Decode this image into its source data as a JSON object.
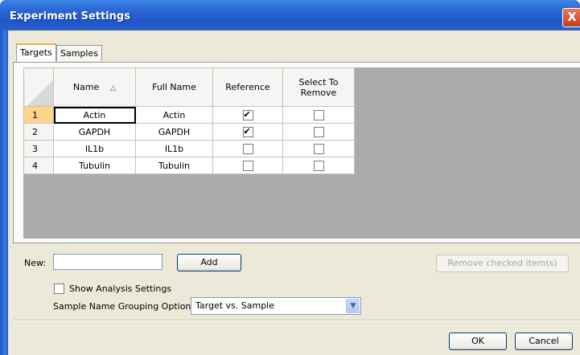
{
  "window": {
    "title": "Experiment Settings",
    "close_glyph": "X"
  },
  "tabs": [
    {
      "label": "Targets",
      "active": true
    },
    {
      "label": "Samples",
      "active": false
    }
  ],
  "grid": {
    "columns": [
      {
        "label": "Name",
        "sort": "ascending"
      },
      {
        "label": "Full Name"
      },
      {
        "label": "Reference"
      },
      {
        "label": "Select To\nRemove"
      }
    ],
    "rows": [
      {
        "index": "1",
        "name": "Actin",
        "full_name": "Actin",
        "reference": true,
        "remove": false
      },
      {
        "index": "2",
        "name": "GAPDH",
        "full_name": "GAPDH",
        "reference": true,
        "remove": false
      },
      {
        "index": "3",
        "name": "IL1b",
        "full_name": "IL1b",
        "reference": false,
        "remove": false
      },
      {
        "index": "4",
        "name": "Tubulin",
        "full_name": "Tubulin",
        "reference": false,
        "remove": false
      }
    ]
  },
  "new_item": {
    "label": "New:",
    "value": "",
    "add_label": "Add"
  },
  "remove_checked_label": "Remove checked item(s)",
  "show_analysis": {
    "label": "Show Analysis Settings",
    "checked": false
  },
  "grouping": {
    "label": "Sample Name Grouping Option:",
    "selected": "Target vs. Sample"
  },
  "footer": {
    "ok_label": "OK",
    "cancel_label": "Cancel"
  }
}
